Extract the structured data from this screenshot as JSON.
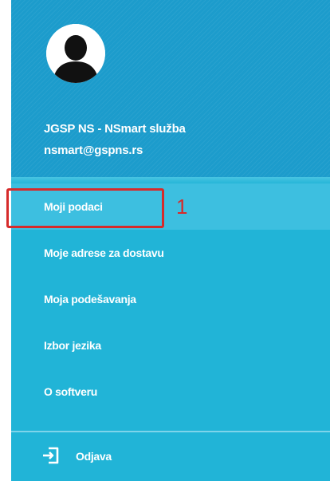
{
  "user": {
    "name": "JGSP NS - NSmart služba",
    "email": "nsmart@gspns.rs",
    "avatar_icon": "user-silhouette-icon"
  },
  "menu": {
    "items": [
      {
        "label": "Moji podaci",
        "active": true
      },
      {
        "label": "Moje adrese za dostavu",
        "active": false
      },
      {
        "label": "Moja podešavanja",
        "active": false
      },
      {
        "label": "Izbor jezika",
        "active": false
      },
      {
        "label": "O softveru",
        "active": false
      }
    ]
  },
  "annotation": {
    "number": "1",
    "color": "#d62b2b"
  },
  "logout": {
    "label": "Odjava",
    "icon": "logout-icon"
  },
  "colors": {
    "header": "#1c9ccc",
    "drawer": "#21b4d7",
    "active_item": "#3dbfe0",
    "text": "#ffffff"
  }
}
